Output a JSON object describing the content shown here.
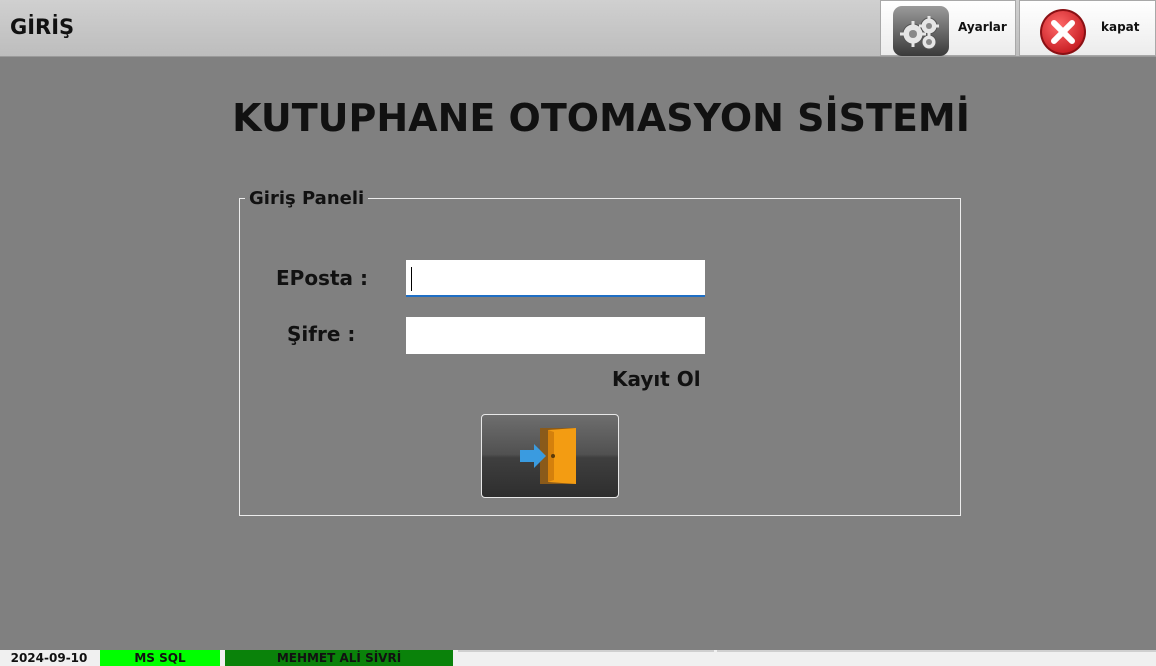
{
  "window": {
    "title": "GİRİŞ"
  },
  "toolbar": {
    "settings_label": "Ayarlar",
    "settings_icon": "gear-icon",
    "close_label": "kapat",
    "close_icon": "close-icon"
  },
  "main": {
    "title": "KUTUPHANE OTOMASYON SİSTEMİ"
  },
  "login_panel": {
    "legend": "Giriş Paneli",
    "email_label": "EPosta :",
    "email_value": "",
    "password_label": "Şifre :",
    "password_value": "",
    "register_link": "Kayıt Ol",
    "login_icon": "door-enter-icon"
  },
  "status_bar": {
    "date": "2024-09-10",
    "database": "MS SQL",
    "user": "MEHMET ALİ SİVRİ"
  },
  "colors": {
    "background": "#808080",
    "db_status": "#00ff00",
    "user_status": "#0a820a",
    "close_red": "#d9262c",
    "input_focus": "#1f6fc5"
  }
}
